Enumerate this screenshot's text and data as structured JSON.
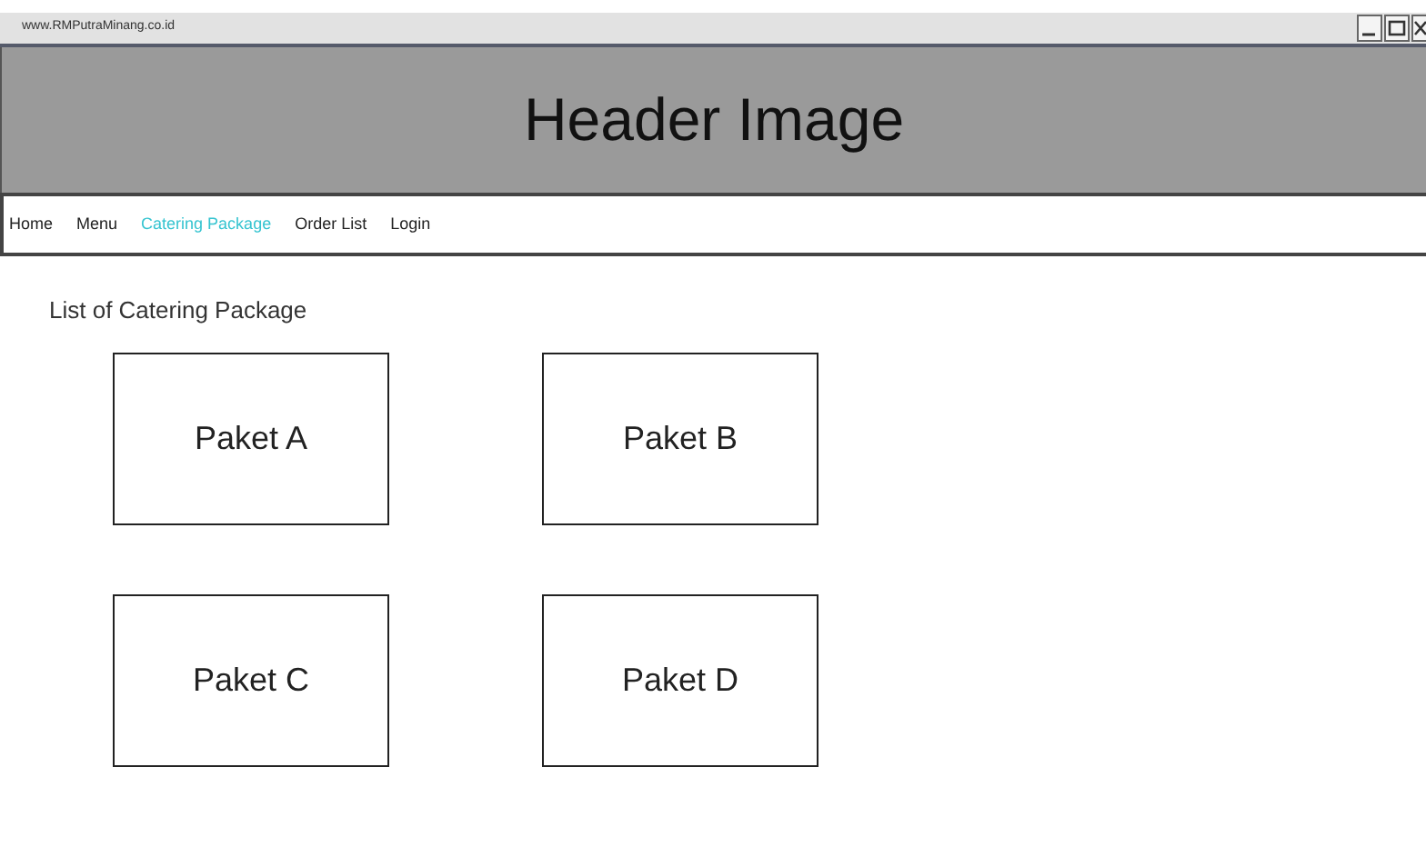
{
  "window": {
    "title": "www.RMPutraMinang.co.id"
  },
  "header": {
    "text": "Header Image"
  },
  "nav": [
    {
      "label": "Home",
      "selected": false
    },
    {
      "label": "Menu",
      "selected": false
    },
    {
      "label": "Catering Package",
      "selected": true
    },
    {
      "label": "Order List",
      "selected": false
    },
    {
      "label": "Login",
      "selected": false
    }
  ],
  "section_title": "List of Catering Package",
  "packages": [
    "Paket A",
    "Paket B",
    "Paket C",
    "Paket D"
  ]
}
